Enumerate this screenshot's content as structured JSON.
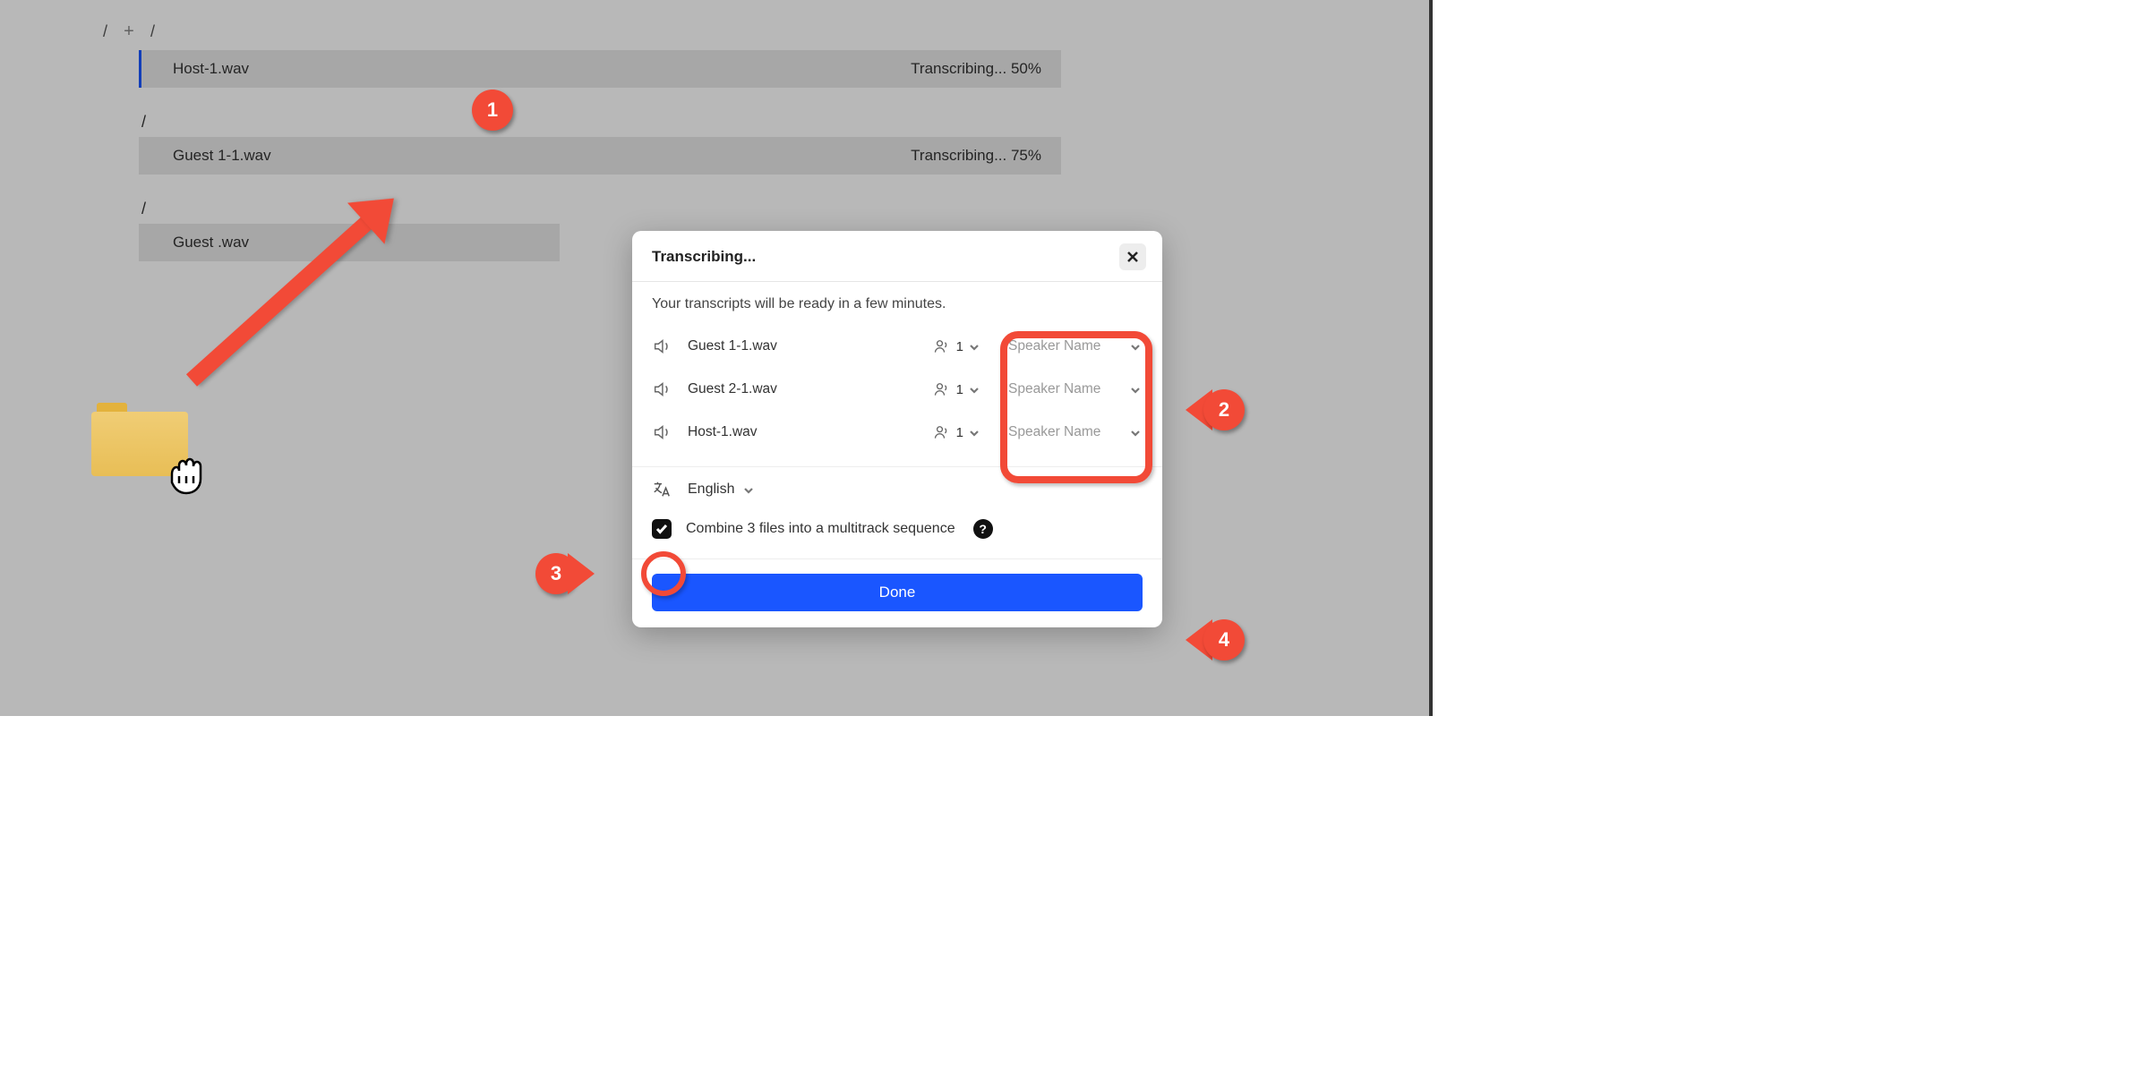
{
  "doc": {
    "files": [
      {
        "name": "Host-1.wav",
        "status": "Transcribing... 50%"
      },
      {
        "name": "Guest 1-1.wav",
        "status": "Transcribing... 75%"
      },
      {
        "name": "Guest    .wav",
        "status": ""
      }
    ]
  },
  "modal": {
    "title": "Transcribing...",
    "subtitle": "Your transcripts will be ready in a few minutes.",
    "files": [
      {
        "name": "Guest 1-1.wav",
        "count": "1",
        "speaker": "Speaker Name"
      },
      {
        "name": "Guest 2-1.wav",
        "count": "1",
        "speaker": "Speaker Name"
      },
      {
        "name": "Host-1.wav",
        "count": "1",
        "speaker": "Speaker Name"
      }
    ],
    "language": "English",
    "combine_label": "Combine 3 files into a multitrack sequence",
    "help": "?",
    "done": "Done"
  },
  "annotations": {
    "a1": "1",
    "a2": "2",
    "a3": "3",
    "a4": "4"
  }
}
